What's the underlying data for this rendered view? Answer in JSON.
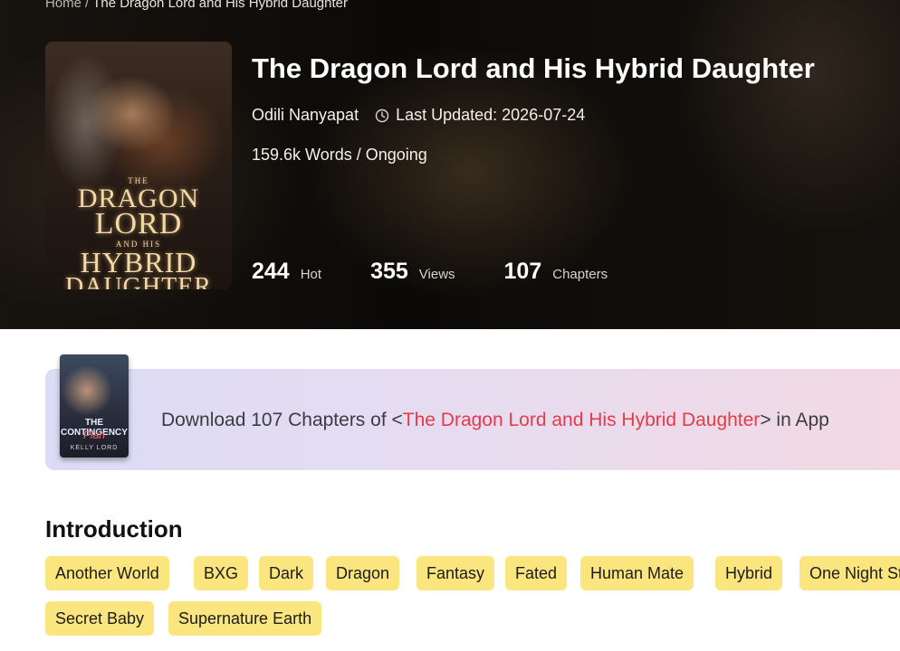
{
  "breadcrumb": {
    "home": "Home",
    "separator": "/",
    "current": "The Dragon Lord and His Hybrid Daughter"
  },
  "book": {
    "title": "The Dragon Lord and His Hybrid Daughter",
    "author": "Odili Nanyapat",
    "last_updated": "Last Updated: 2026-07-24",
    "words_status": "159.6k Words / Ongoing",
    "cover_text": {
      "line1": "THE",
      "line2": "DRAGON",
      "line3": "LORD",
      "line4": "AND HIS",
      "line5": "HYBRID",
      "line6": "DAUGHTER"
    },
    "stats": [
      {
        "value": "244",
        "label": "Hot"
      },
      {
        "value": "355",
        "label": "Views"
      },
      {
        "value": "107",
        "label": "Chapters"
      }
    ]
  },
  "banner": {
    "prefix": "Download 107 Chapters of <",
    "highlight": "The Dragon Lord and His Hybrid Daughter",
    "suffix": "> in App",
    "promo_cover": {
      "title": "THE CONTINGENCY",
      "subtitle": "Plan",
      "author": "KELLY LORD"
    }
  },
  "intro": {
    "heading": "Introduction",
    "tags": [
      "Another World",
      "BXG",
      "Dark",
      "Dragon",
      "Fantasy",
      "Fated",
      "Human Mate",
      "Hybrid",
      "One Night Stand",
      "Secret Baby",
      "Supernature Earth"
    ]
  },
  "colors": {
    "tag_bg": "#fbe57f",
    "highlight": "#e43b4b",
    "hero_bg": "#0c0a08"
  },
  "icons": {
    "last_updated": "clock-icon"
  }
}
